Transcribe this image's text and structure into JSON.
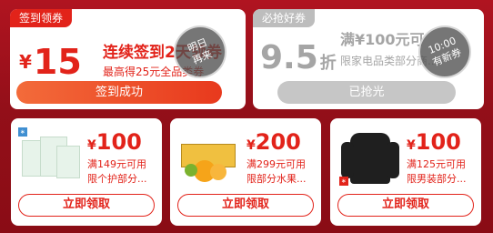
{
  "signin_card": {
    "tag": "签到领券",
    "currency": "¥",
    "amount": "15",
    "title": "连续签到2天领券",
    "subtitle": "最高得25元全品类券",
    "stamp_line1": "明日",
    "stamp_line2": "再来",
    "button": "签到成功"
  },
  "must_grab_card": {
    "tag": "必抢好券",
    "amount": "9.5",
    "unit": "折",
    "title": "满¥100元可",
    "subtitle": "限家电品类部分商...",
    "stamp_line1": "10:00",
    "stamp_line2": "有新券",
    "button": "已抢光"
  },
  "products": [
    {
      "currency": "¥",
      "amount": "100",
      "condition": "满149元可用",
      "scope": "限个护部分...",
      "button": "立即领取",
      "image_icon": "supplement-box-icon"
    },
    {
      "currency": "¥",
      "amount": "200",
      "condition": "满299元可用",
      "scope": "限部分水果...",
      "button": "立即领取",
      "image_icon": "orange-crate-icon"
    },
    {
      "currency": "¥",
      "amount": "100",
      "condition": "满125元可用",
      "scope": "限男装部分...",
      "button": "立即领取",
      "image_icon": "jacket-icon"
    }
  ],
  "colors": {
    "background": "#8d0d16",
    "accent_red": "#e2231a",
    "gray": "#a5a5a5"
  }
}
